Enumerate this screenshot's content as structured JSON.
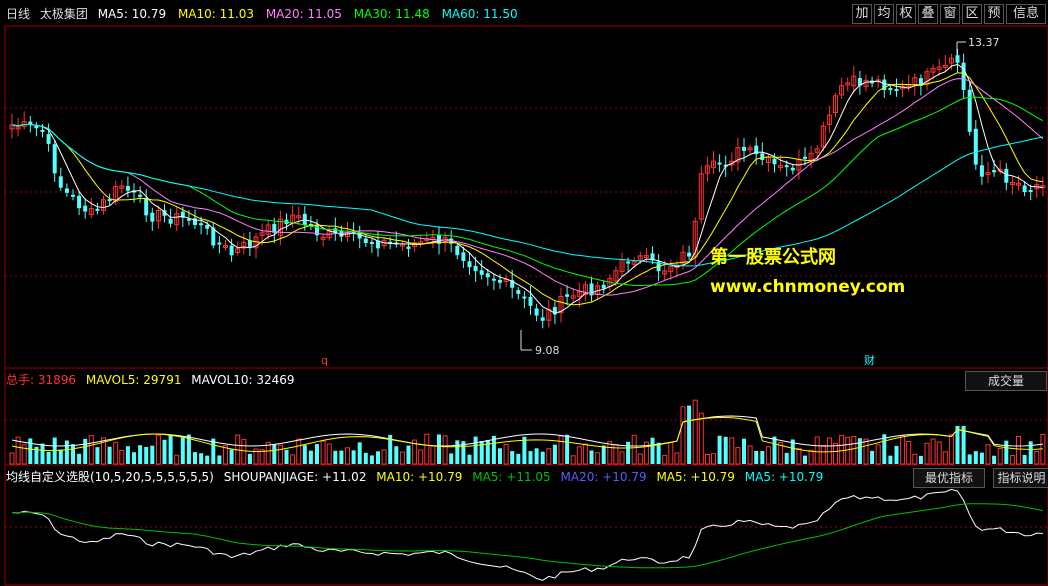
{
  "main": {
    "period": "日线",
    "stock": "太极集团",
    "ma5": "MA5: 10.79",
    "ma10": "MA10: 11.03",
    "ma20": "MA20: 11.05",
    "ma30": "MA30: 11.48",
    "ma60": "MA60: 11.50",
    "high_label": "13.37",
    "low_label": "9.08",
    "marker_q": "q",
    "marker_cai": "财"
  },
  "toolbar": [
    "加",
    "均",
    "权",
    "叠",
    "窗",
    "区",
    "预",
    "信息"
  ],
  "volume": {
    "total": "总手: 31896",
    "mavol5": "MAVOL5: 29791",
    "mavol10": "MAVOL10: 32469",
    "button": "成交量"
  },
  "indicator": {
    "name": "均线自定义选股(10,5,20,5,5,5,5,5,5)",
    "shoupanjiage": "SHOUPANJIAGE: +11.02",
    "ma10": "MA10: +10.79",
    "ma5a": "MA5: +11.05",
    "ma20": "MA20: +10.79",
    "ma5b": "MA5: +10.79",
    "ma5c": "MA5: +10.79",
    "btn_best": "最优指标",
    "btn_help": "指标说明"
  },
  "watermark": {
    "line1": "第一股票公式网",
    "line2": "www.chnmoney.com"
  },
  "colors": {
    "up": "#ff3232",
    "down": "#54ffff",
    "ma5": "#ffffff",
    "ma10": "#ffff00",
    "ma20": "#ff80ff",
    "ma30": "#00ff00",
    "ma60": "#00ffff",
    "grid": "#a00000"
  }
}
